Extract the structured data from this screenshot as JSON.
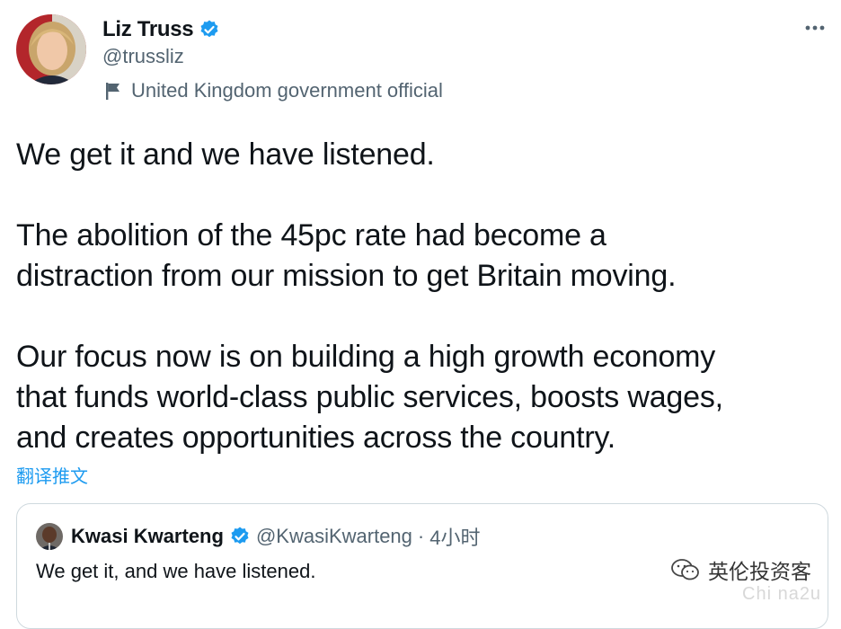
{
  "author": {
    "name": "Liz Truss",
    "handle": "@trussliz",
    "label": "United Kingdom government official"
  },
  "tweet": {
    "text": "We get it and we have listened.\n\nThe abolition of the 45pc rate had become a\ndistraction from our mission to get Britain moving.\n\nOur focus now is on building a high growth economy\nthat funds world-class public services, boosts wages,\nand creates opportunities across the country.",
    "translate_label": "翻译推文"
  },
  "quoted": {
    "name": "Kwasi Kwarteng",
    "handle": "@KwasiKwarteng",
    "separator": "·",
    "time": "4小时",
    "text": "We get it, and we have listened."
  },
  "watermark": {
    "label": "英伦投资客",
    "sub": "Chi na2u"
  },
  "icons": {
    "verified": "verified-badge-icon",
    "flag": "flag-icon",
    "more": "more-options-icon"
  },
  "colors": {
    "accent": "#1d9bf0",
    "secondary_text": "#536471",
    "border": "#cfd9de"
  }
}
